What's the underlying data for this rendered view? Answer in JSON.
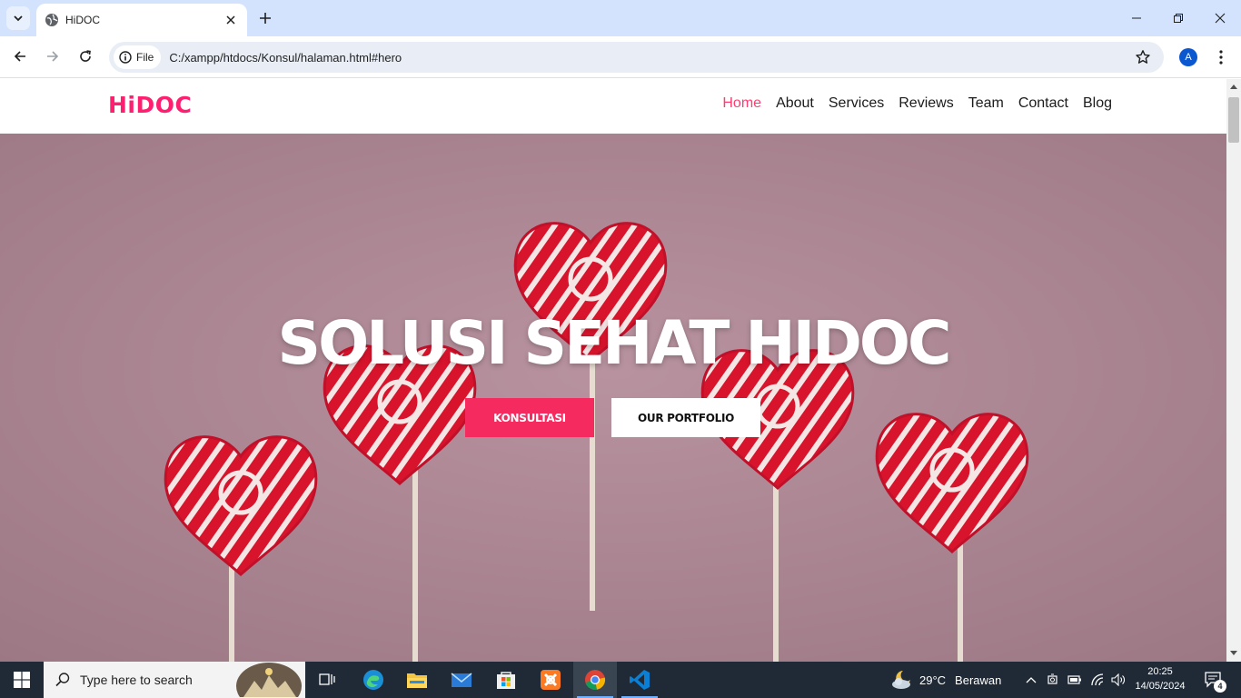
{
  "browser": {
    "tab_title": "HiDOC",
    "site_chip_label": "File",
    "url": "C:/xampp/htdocs/Konsul/halaman.html#hero",
    "profile_initial": "A"
  },
  "site": {
    "logo": "HiDOC",
    "nav": [
      {
        "label": "Home",
        "active": true
      },
      {
        "label": "About"
      },
      {
        "label": "Services"
      },
      {
        "label": "Reviews"
      },
      {
        "label": "Team"
      },
      {
        "label": "Contact"
      },
      {
        "label": "Blog"
      }
    ],
    "hero": {
      "title": "SOLUSI SEHAT HIDOC",
      "primary_button": "KONSULTASI",
      "secondary_button": "OUR PORTFOLIO"
    },
    "colors": {
      "accent": "#ff1f70",
      "button": "#f52a5f",
      "hero_bg": "#b08c98"
    }
  },
  "taskbar": {
    "search_placeholder": "Type here to search",
    "apps": [
      "task-view",
      "edge",
      "file-explorer",
      "mail",
      "store",
      "xampp",
      "chrome",
      "vscode"
    ],
    "active_app": "chrome",
    "weather": {
      "temp": "29°C",
      "condition": "Berawan"
    },
    "time": "20:25",
    "date": "14/05/2024",
    "notification_count": "4"
  }
}
